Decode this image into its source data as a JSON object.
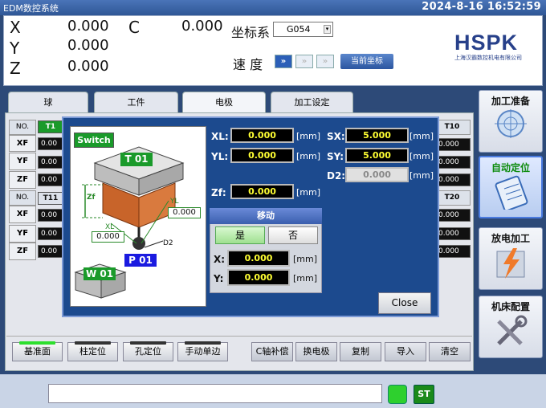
{
  "title_bar": {
    "app_title": "EDM数控系统",
    "datetime": "2024-8-16 16:52:59"
  },
  "header": {
    "axes": [
      {
        "name": "X",
        "value": "0.000"
      },
      {
        "name": "Y",
        "value": "0.000"
      },
      {
        "name": "Z",
        "value": "0.000"
      }
    ],
    "c_axis": {
      "name": "C",
      "value": "0.000"
    },
    "coord_label": "坐标系",
    "coord_value": "G054",
    "speed_label": "速 度",
    "current_coord_button": "当前坐标",
    "logo": {
      "brand": "HSPK",
      "company": "上海汉霸数控机电有限公司"
    }
  },
  "tabs": [
    "球",
    "工件",
    "电极",
    "加工设定"
  ],
  "grid": {
    "top": {
      "header": "NO.",
      "t_label": "T1",
      "t_right": "T10",
      "rows": [
        "XF",
        "YF",
        "ZF"
      ],
      "left_val": "0.00",
      "right_val": "0.000"
    },
    "bottom": {
      "header": "NO.",
      "t_label": "T11",
      "t_right": "T20",
      "rows": [
        "XF",
        "YF",
        "ZF"
      ],
      "left_val": "0.00",
      "right_val": "0.000"
    }
  },
  "dialog": {
    "switch_label": "Switch",
    "diagram": {
      "t_label": "T 01",
      "p_label": "P 01",
      "w_label": "W 01",
      "zf": "Zf",
      "yl": "YL",
      "xl": "XL",
      "d2": "D2",
      "yl_value": "0.000",
      "xl_value": "0.000"
    },
    "fields_left": [
      {
        "label": "XL:",
        "value": "0.000",
        "unit": "[mm]"
      },
      {
        "label": "YL:",
        "value": "0.000",
        "unit": "[mm]"
      },
      {
        "label": "Zf:",
        "value": "0.000",
        "unit": "[mm]"
      }
    ],
    "fields_right": [
      {
        "label": "SX:",
        "value": "5.000",
        "unit": "[mm]"
      },
      {
        "label": "SY:",
        "value": "5.000",
        "unit": "[mm]"
      },
      {
        "label": "D2:",
        "value": "0.000",
        "unit": "[mm]"
      }
    ],
    "move": {
      "title": "移动",
      "yes": "是",
      "no": "否",
      "x": {
        "label": "X:",
        "value": "0.000",
        "unit": "[mm]"
      },
      "y": {
        "label": "Y:",
        "value": "0.000",
        "unit": "[mm]"
      }
    },
    "close": "Close"
  },
  "bottom_buttons": {
    "left": [
      "基准面",
      "柱定位",
      "孔定位",
      "手动单边"
    ],
    "right": [
      "C轴补偿",
      "换电极",
      "复制",
      "导入",
      "清空"
    ]
  },
  "sidebar": [
    {
      "label": "加工准备",
      "icon": "crosshair-icon"
    },
    {
      "label": "自动定位",
      "icon": "clipboard-icon",
      "active": true
    },
    {
      "label": "放电加工",
      "icon": "spark-icon"
    },
    {
      "label": "机床配置",
      "icon": "wrench-icon"
    }
  ],
  "status": {
    "st_label": "ST"
  }
}
